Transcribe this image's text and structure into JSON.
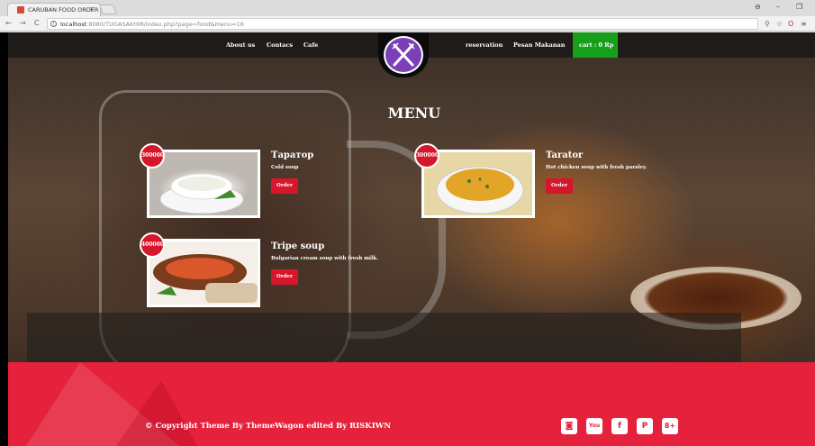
{
  "browser": {
    "tab_title": "CARUBAN FOOD ORDER",
    "tab_close": "×",
    "url_host": "localhost",
    "url_rest": ":8080/TUGASAKHIR/index.php?page=food&menu=16",
    "back": "←",
    "forward": "→",
    "reload": "C",
    "minimize": "–",
    "restore": "❐"
  },
  "nav": {
    "left_links": [
      "About us",
      "Contacs",
      "Cafe"
    ],
    "right_links": [
      "reservation",
      "Pesan Makanan"
    ],
    "cart_label": "cart : 0 Rp"
  },
  "menu": {
    "title": "MENU",
    "items": [
      {
        "price": "300000",
        "name": "Таратор",
        "desc": "Cold soup",
        "order_label": "Order"
      },
      {
        "price": "300000",
        "name": "Tarator",
        "desc": "Hot chicken soup with fresh parsley.",
        "order_label": "Order"
      },
      {
        "price": "400000",
        "name": "Tripe soup",
        "desc": "Bulgarian cream soup with fresh milk.",
        "order_label": "Order"
      }
    ]
  },
  "footer": {
    "copyright": "© Copyright Theme By ThemeWagon edited By RISKIWN",
    "social": [
      "instagram-icon",
      "youtube-icon",
      "facebook-icon",
      "pinterest-icon",
      "google-plus-icon"
    ],
    "social_glyphs": [
      "◙",
      "You",
      "f",
      "P",
      "8+"
    ]
  },
  "colors": {
    "accent_red": "#e5213c",
    "cart_green": "#16a01a",
    "logo_purple": "#7b3fb8"
  }
}
